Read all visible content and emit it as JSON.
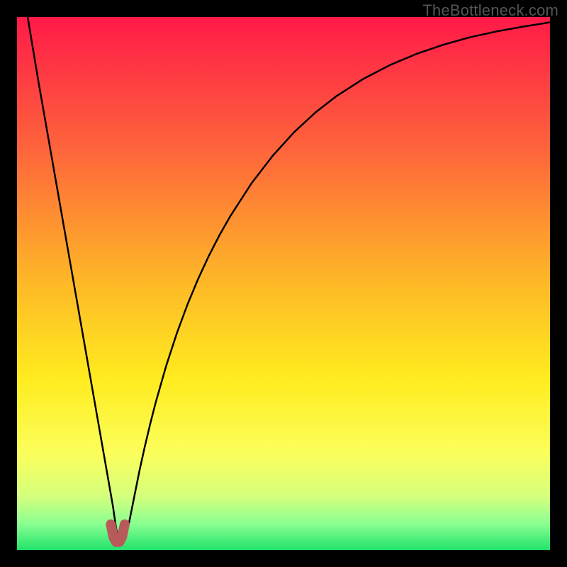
{
  "watermark": "TheBottleneck.com",
  "chart_data": {
    "type": "line",
    "title": "",
    "xlabel": "",
    "ylabel": "",
    "xlim": [
      0,
      100
    ],
    "ylim": [
      0,
      100
    ],
    "background_gradient": {
      "stops": [
        {
          "offset": 0.0,
          "color": "#ff1a48"
        },
        {
          "offset": 0.25,
          "color": "#fe653b"
        },
        {
          "offset": 0.5,
          "color": "#feb927"
        },
        {
          "offset": 0.68,
          "color": "#ffec1f"
        },
        {
          "offset": 0.82,
          "color": "#fbff5c"
        },
        {
          "offset": 0.9,
          "color": "#d4ff7d"
        },
        {
          "offset": 0.95,
          "color": "#8cff91"
        },
        {
          "offset": 1.0,
          "color": "#21e36b"
        }
      ]
    },
    "series": [
      {
        "name": "bottleneck-curve",
        "color": "#000000",
        "width": 2.5,
        "x": [
          2,
          3,
          4,
          5,
          6,
          7,
          8,
          9,
          10,
          11,
          12,
          13,
          14,
          15,
          16,
          17,
          18,
          18.6,
          19.2,
          20,
          21,
          22,
          23,
          24,
          25,
          26,
          28,
          30,
          32,
          34,
          36,
          38,
          40,
          44,
          48,
          52,
          56,
          60,
          65,
          70,
          75,
          80,
          85,
          90,
          95,
          100
        ],
        "y": [
          100,
          94,
          88,
          82.3,
          76.6,
          70.9,
          65.2,
          59.5,
          53.8,
          48.1,
          42.4,
          36.7,
          31,
          25.3,
          19.6,
          13.9,
          8.2,
          4,
          1.8,
          2.2,
          5,
          10,
          15,
          19.5,
          23.7,
          27.6,
          34.6,
          40.7,
          46.1,
          50.9,
          55.2,
          59.1,
          62.6,
          68.8,
          74,
          78.4,
          82.1,
          85.2,
          88.4,
          91,
          93.1,
          94.8,
          96.2,
          97.3,
          98.2,
          99
        ]
      },
      {
        "name": "valley-marker",
        "type": "marker",
        "color": "#b85a5a",
        "stroke_width": 14,
        "x": [
          17.6,
          18.1,
          18.6,
          19.2,
          19.7,
          20.2
        ],
        "y": [
          4.8,
          2.4,
          1.5,
          1.5,
          2.4,
          4.8
        ]
      }
    ]
  }
}
